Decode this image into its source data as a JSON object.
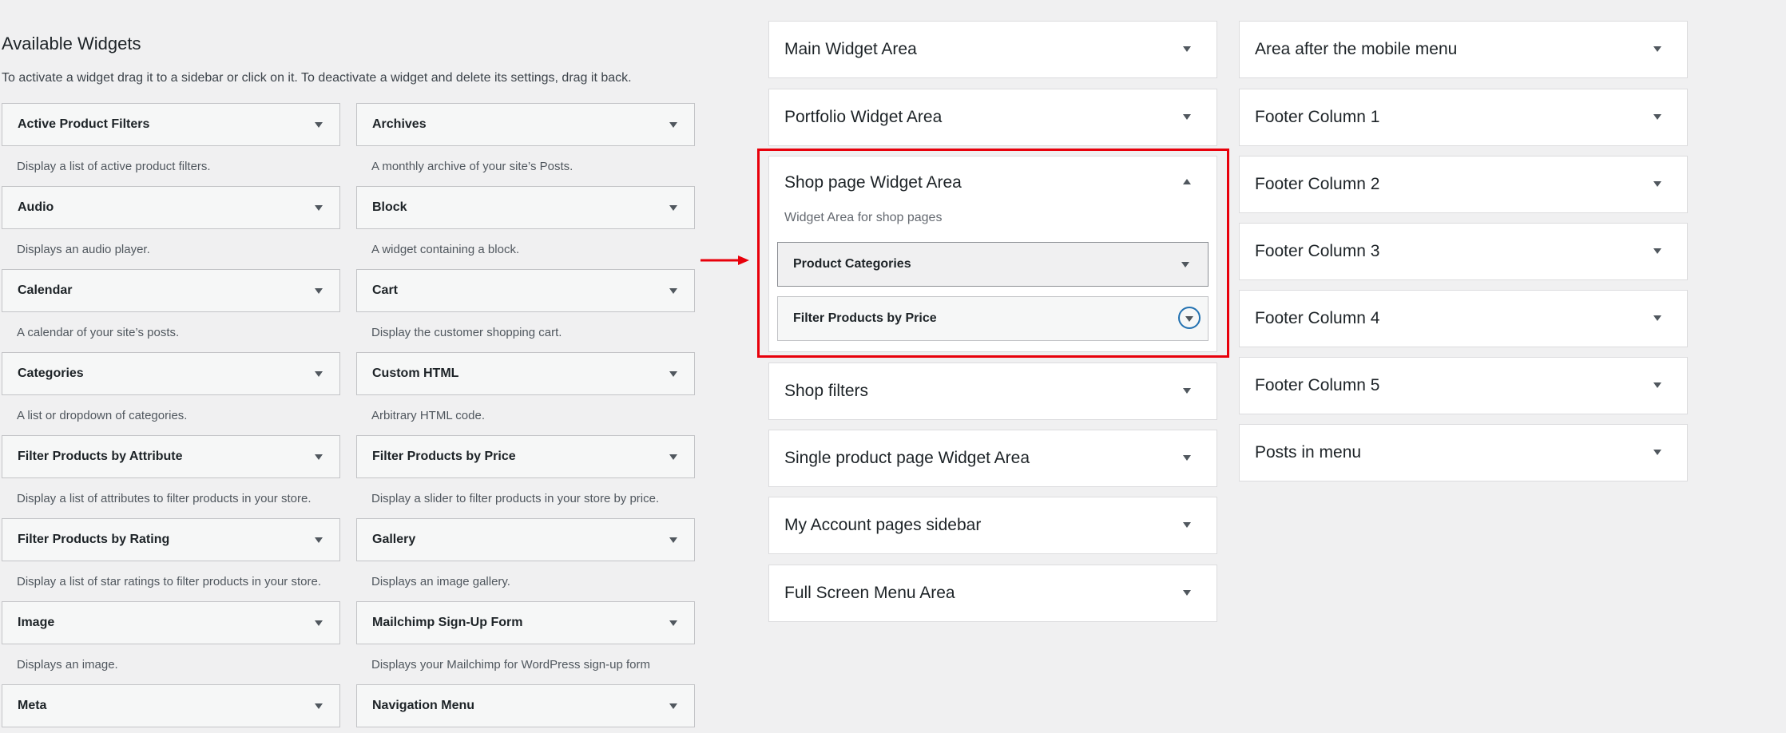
{
  "available": {
    "title": "Available Widgets",
    "description": "To activate a widget drag it to a sidebar or click on it. To deactivate a widget and delete its settings, drag it back.",
    "widgets": [
      {
        "name": "Active Product Filters",
        "desc": "Display a list of active product filters."
      },
      {
        "name": "Archives",
        "desc": "A monthly archive of your site’s Posts."
      },
      {
        "name": "Audio",
        "desc": "Displays an audio player."
      },
      {
        "name": "Block",
        "desc": "A widget containing a block."
      },
      {
        "name": "Calendar",
        "desc": "A calendar of your site’s posts."
      },
      {
        "name": "Cart",
        "desc": "Display the customer shopping cart."
      },
      {
        "name": "Categories",
        "desc": "A list or dropdown of categories."
      },
      {
        "name": "Custom HTML",
        "desc": "Arbitrary HTML code."
      },
      {
        "name": "Filter Products by Attribute",
        "desc": "Display a list of attributes to filter products in your store."
      },
      {
        "name": "Filter Products by Price",
        "desc": "Display a slider to filter products in your store by price."
      },
      {
        "name": "Filter Products by Rating",
        "desc": "Display a list of star ratings to filter products in your store."
      },
      {
        "name": "Gallery",
        "desc": "Displays an image gallery."
      },
      {
        "name": "Image",
        "desc": "Displays an image."
      },
      {
        "name": "Mailchimp Sign-Up Form",
        "desc": "Displays your Mailchimp for WordPress sign-up form"
      },
      {
        "name": "Meta",
        "desc": ""
      },
      {
        "name": "Navigation Menu",
        "desc": ""
      }
    ]
  },
  "sidebars_col1": {
    "main": "Main Widget Area",
    "portfolio": "Portfolio Widget Area",
    "shop": {
      "title": "Shop page Widget Area",
      "description": "Widget Area for shop pages",
      "widgets": [
        "Product Categories",
        "Filter Products by Price"
      ]
    },
    "shop_filters": "Shop filters",
    "single_product": "Single product page Widget Area",
    "my_account": "My Account pages sidebar",
    "full_screen_menu": "Full Screen Menu Area"
  },
  "sidebars_col2": [
    "Area after the mobile menu",
    "Footer Column 1",
    "Footer Column 2",
    "Footer Column 3",
    "Footer Column 4",
    "Footer Column 5",
    "Posts in menu"
  ],
  "colors": {
    "highlight": "#e8000b",
    "focus": "#2271b1",
    "background": "#f0f0f1"
  }
}
